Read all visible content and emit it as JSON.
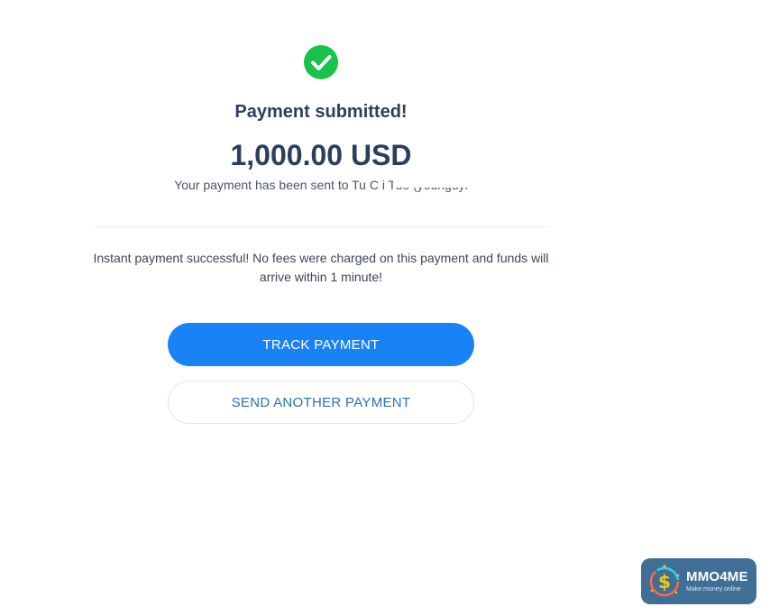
{
  "confirmation": {
    "title": "Payment submitted!",
    "amount": "1,000.00 USD",
    "sent_text": "Your payment has been sent to Tu C      i Tue (younguyl                    ",
    "note": "Instant payment successful! No fees were charged on this payment and funds will arrive within 1 minute!"
  },
  "actions": {
    "track_label": "TRACK PAYMENT",
    "send_another_label": "SEND ANOTHER PAYMENT"
  },
  "watermark": {
    "title": "MMO4ME",
    "subtitle": "Make money online"
  },
  "colors": {
    "success": "#1bc24a",
    "primary": "#1a82f7",
    "text": "#2c3e5b",
    "watermark_bg": "#3f6f97"
  },
  "icons": {
    "success": "check-circle-icon"
  }
}
